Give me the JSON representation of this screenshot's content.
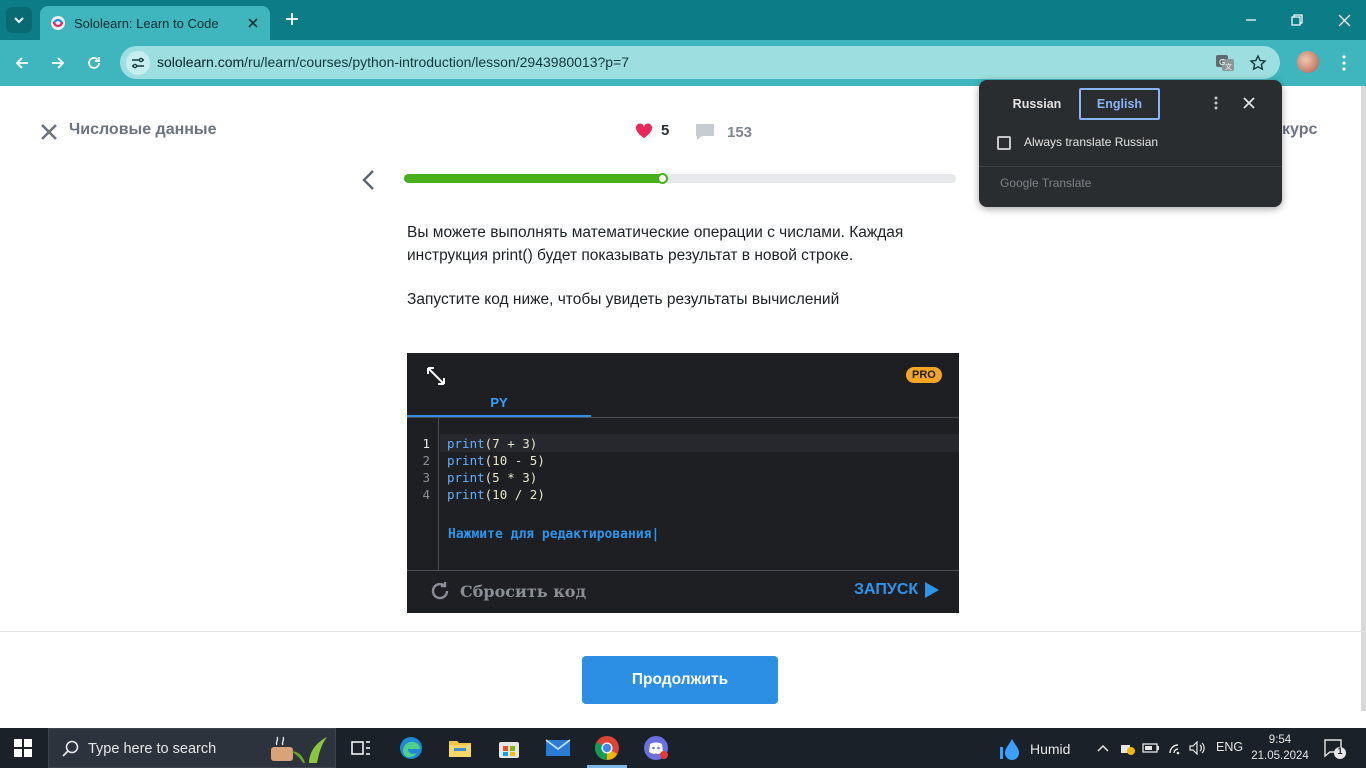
{
  "browser": {
    "tab_title": "Sololearn: Learn to Code",
    "url_host": "sololearn.com",
    "url_path": "/ru/learn/courses/python-introduction/lesson/2943980013?p=7"
  },
  "lesson": {
    "title": "Числовые данные",
    "hearts": "5",
    "comments": "153",
    "course_link": "курс",
    "progress": 0.47,
    "paragraph1": "Вы можете выполнять математические операции с числами. Каждая инструкция print() будет показывать результат в новой строке.",
    "paragraph2": "Запустите код ниже, чтобы увидеть результаты вычислений"
  },
  "code_widget": {
    "pro_badge": "PRO",
    "language_tab": "PY",
    "lines": [
      {
        "num": "1",
        "fn": "print",
        "args": "(7 + 3)"
      },
      {
        "num": "2",
        "fn": "print",
        "args": "(10 - 5)"
      },
      {
        "num": "3",
        "fn": "print",
        "args": "(5 * 3)"
      },
      {
        "num": "4",
        "fn": "print",
        "args": "(10 / 2)"
      }
    ],
    "edit_hint": "Нажмите для редактирования|",
    "reset_label": "Сбросить код",
    "run_label": "ЗАПУСК"
  },
  "continue_button": "Продолжить",
  "translate_popup": {
    "source_lang": "Russian",
    "target_lang": "English",
    "always_translate": "Always translate Russian",
    "always_translate_checked": false,
    "brand": "Google Translate"
  },
  "taskbar": {
    "search_placeholder": "Type here to search",
    "weather": "Humid",
    "language": "ENG",
    "time": "9:54",
    "date": "21.05.2024",
    "notifications": "1"
  },
  "colors": {
    "tabstrip": "#0c7d87",
    "toolbar": "#3fb6bd",
    "progress_green": "#48b01a",
    "accent_blue": "#2c8fe3",
    "heart_red": "#e8285a",
    "pro_orange": "#f6a623"
  }
}
